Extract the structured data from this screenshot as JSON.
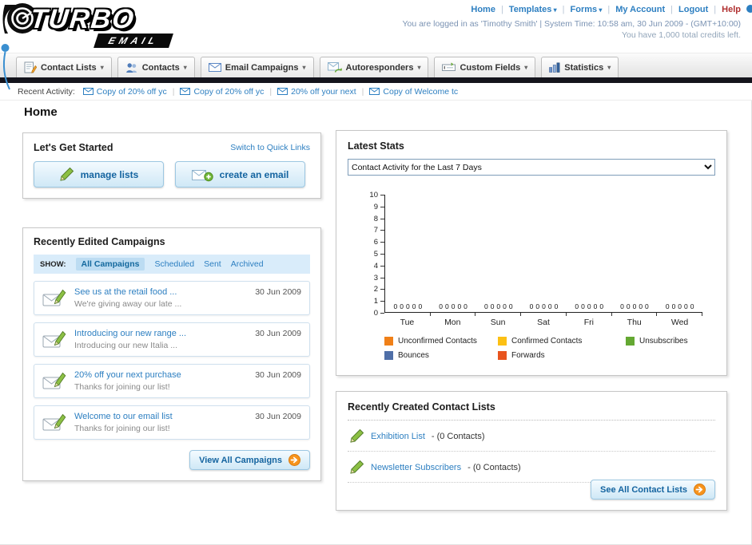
{
  "page": {
    "title": "Home"
  },
  "brand": {
    "name": "TURBO",
    "sub": "EMAIL"
  },
  "header": {
    "links": [
      {
        "label": "Home"
      },
      {
        "label": "Templates",
        "has_menu": true
      },
      {
        "label": "Forms",
        "has_menu": true
      },
      {
        "label": "My Account"
      },
      {
        "label": "Logout"
      },
      {
        "label": "Help",
        "style": "help"
      }
    ],
    "login_info": "You are logged in as 'Timothy Smith' | System Time: 10:58 am, 30 Jun 2009 - (GMT+10:00)",
    "credits_info": "You have 1,000 total credits left."
  },
  "nav_tabs": [
    {
      "label": "Contact Lists",
      "icon": "contact-lists-icon"
    },
    {
      "label": "Contacts",
      "icon": "contacts-icon"
    },
    {
      "label": "Email Campaigns",
      "icon": "email-campaigns-icon"
    },
    {
      "label": "Autoresponders",
      "icon": "autoresponders-icon"
    },
    {
      "label": "Custom Fields",
      "icon": "custom-fields-icon"
    },
    {
      "label": "Statistics",
      "icon": "statistics-icon"
    }
  ],
  "recent_activity": {
    "label": "Recent Activity:",
    "items": [
      "Copy of 20% off yc",
      "Copy of 20% off yc",
      "20% off your next",
      "Copy of Welcome tc"
    ]
  },
  "get_started": {
    "title": "Let's Get Started",
    "switch_label": "Switch to Quick Links",
    "manage_lists_label": "manage lists",
    "create_email_label": "create an email"
  },
  "campaigns": {
    "title": "Recently Edited Campaigns",
    "show_label": "SHOW:",
    "filters": [
      "All Campaigns",
      "Scheduled",
      "Sent",
      "Archived"
    ],
    "selected_filter": 0,
    "items": [
      {
        "title": "See us at the retail food ...",
        "subtitle": "We're giving away our late ...",
        "date": "30 Jun 2009"
      },
      {
        "title": "Introducing our new range ...",
        "subtitle": "Introducing our new Italia ...",
        "date": "30 Jun 2009"
      },
      {
        "title": "20% off your next purchase",
        "subtitle": "Thanks for joining our list!",
        "date": "30 Jun 2009"
      },
      {
        "title": "Welcome to our email list",
        "subtitle": "Thanks for joining our list!",
        "date": "30 Jun 2009"
      }
    ],
    "view_all_label": "View All Campaigns"
  },
  "stats": {
    "title": "Latest Stats",
    "dropdown_value": "Contact Activity for the Last 7 Days"
  },
  "chart_data": {
    "type": "bar",
    "title": "Contact Activity for the Last 7 Days",
    "categories": [
      "Tue",
      "Mon",
      "Sun",
      "Sat",
      "Fri",
      "Thu",
      "Wed"
    ],
    "series": [
      {
        "name": "Unconfirmed Contacts",
        "color": "#f08018",
        "values": [
          0,
          0,
          0,
          0,
          0,
          0,
          0
        ]
      },
      {
        "name": "Confirmed Contacts",
        "color": "#fcc014",
        "values": [
          0,
          0,
          0,
          0,
          0,
          0,
          0
        ]
      },
      {
        "name": "Unsubscribes",
        "color": "#64a832",
        "values": [
          0,
          0,
          0,
          0,
          0,
          0,
          0
        ]
      },
      {
        "name": "Bounces",
        "color": "#4f6fa8",
        "values": [
          0,
          0,
          0,
          0,
          0,
          0,
          0
        ]
      },
      {
        "name": "Forwards",
        "color": "#e8541e",
        "values": [
          0,
          0,
          0,
          0,
          0,
          0,
          0
        ]
      }
    ],
    "ylim": [
      0,
      10
    ],
    "yticks": [
      0,
      1,
      2,
      3,
      4,
      5,
      6,
      7,
      8,
      9,
      10
    ],
    "grid": false,
    "legend_position": "bottom",
    "data_labels_shown": true
  },
  "contact_lists": {
    "title": "Recently Created Contact Lists",
    "items": [
      {
        "name": "Exhibition List",
        "count_text": "- (0 Contacts)"
      },
      {
        "name": "Newsletter Subscribers",
        "count_text": "- (0 Contacts)"
      }
    ],
    "see_all_label": "See All Contact Lists"
  },
  "icons": {
    "envelope-icon": "envelope glyph",
    "envelope-pencil-icon": "envelope with green pencil",
    "pencil-icon": "green pencil",
    "envelope-plus-icon": "envelope with green plus",
    "arrow-circle-icon": "orange circle with white arrow",
    "chevron-down-icon": "dropdown arrow"
  },
  "colors": {
    "link_blue": "#2d7fc1",
    "accent_orange": "#f7941d",
    "dark_bar": "#14141c",
    "button_blue_border": "#9cc7e2"
  }
}
